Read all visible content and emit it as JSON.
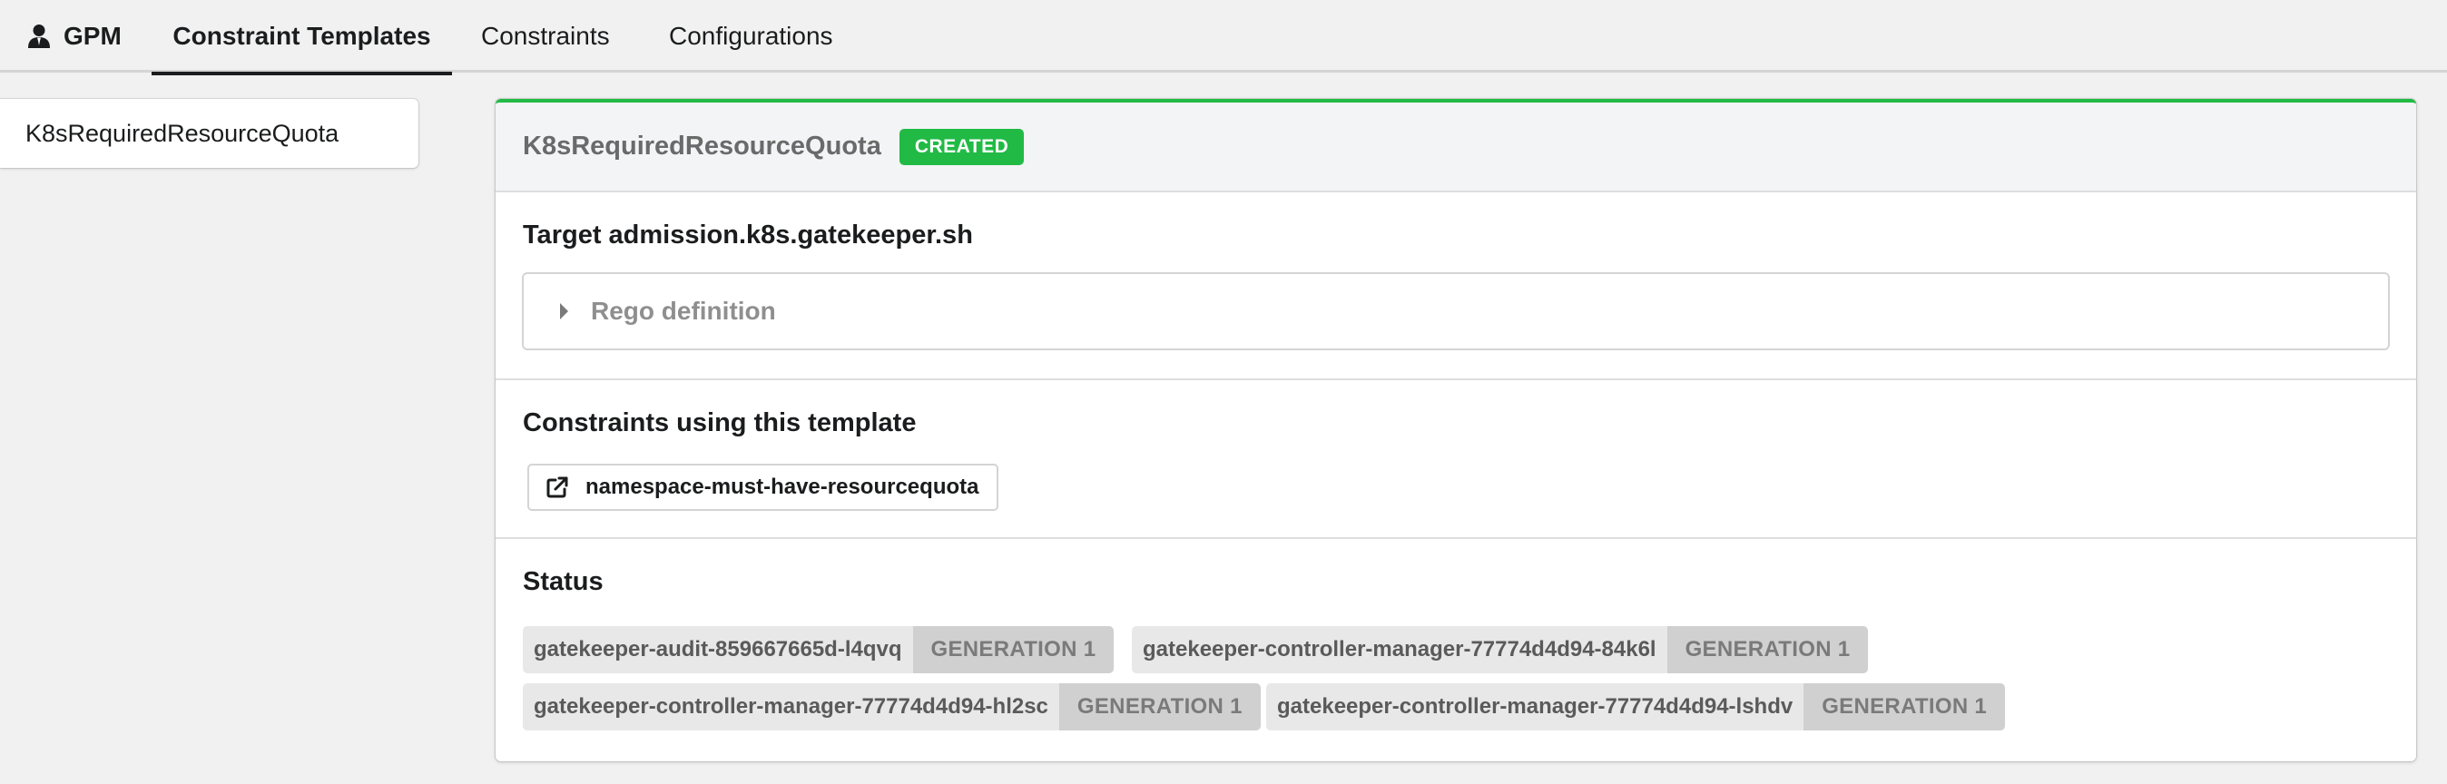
{
  "tabs": {
    "brand": "GPM",
    "templates": "Constraint Templates",
    "constraints": "Constraints",
    "configurations": "Configurations"
  },
  "sidebar": {
    "items": [
      {
        "label": "K8sRequiredResourceQuota"
      }
    ]
  },
  "template": {
    "title": "K8sRequiredResourceQuota",
    "status_label": "CREATED",
    "target_heading": "Target admission.k8s.gatekeeper.sh",
    "rego_label": "Rego definition",
    "constraints_heading": "Constraints using this template",
    "constraints": [
      {
        "label": "namespace-must-have-resourcequota",
        "icon": "external-link-icon"
      }
    ],
    "status_heading": "Status",
    "status": [
      {
        "pod": "gatekeeper-audit-859667665d-l4qvq",
        "generation": "GENERATION 1"
      },
      {
        "pod": "gatekeeper-controller-manager-77774d4d94-84k6l",
        "generation": "GENERATION 1"
      },
      {
        "pod": "gatekeeper-controller-manager-77774d4d94-hl2sc",
        "generation": "GENERATION 1"
      },
      {
        "pod": "gatekeeper-controller-manager-77774d4d94-lshdv",
        "generation": "GENERATION 1"
      }
    ]
  },
  "colors": {
    "accent": "#21ba45",
    "active_tab_underline": "#1b1c1d",
    "background": "#f1f1f1"
  },
  "icons": {
    "brand": "user-icon",
    "rego_toggle": "caret-right-icon"
  }
}
